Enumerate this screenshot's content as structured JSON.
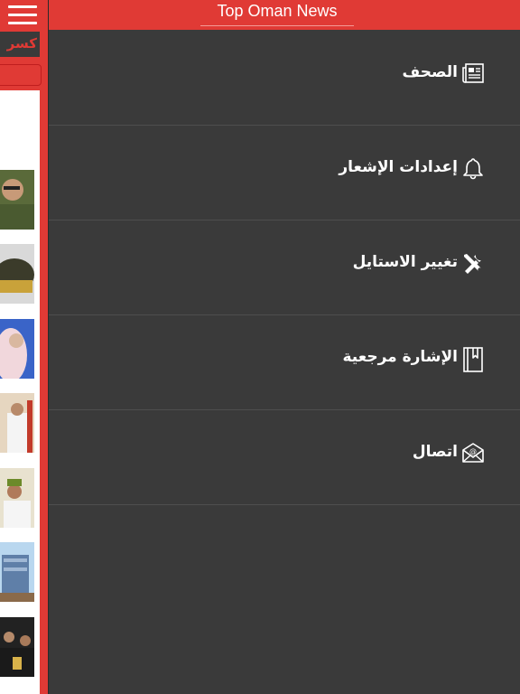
{
  "app": {
    "title": "Top Oman News"
  },
  "background_page": {
    "ticker_text": "كسر",
    "menu_icon": "hamburger-menu-icon"
  },
  "drawer": {
    "items": [
      {
        "label": "الصحف",
        "icon": "newspaper-icon"
      },
      {
        "label": "إعدادات الإشعار",
        "icon": "bell-icon"
      },
      {
        "label": "تغيير الاستايل",
        "icon": "tools-icon"
      },
      {
        "label": "الإشارة مرجعية",
        "icon": "bookmark-icon"
      },
      {
        "label": "اتصال",
        "icon": "email-icon"
      }
    ]
  },
  "colors": {
    "accent": "#e03a35",
    "drawer_bg": "#3a3a3a",
    "divider": "#4e4e4e"
  }
}
